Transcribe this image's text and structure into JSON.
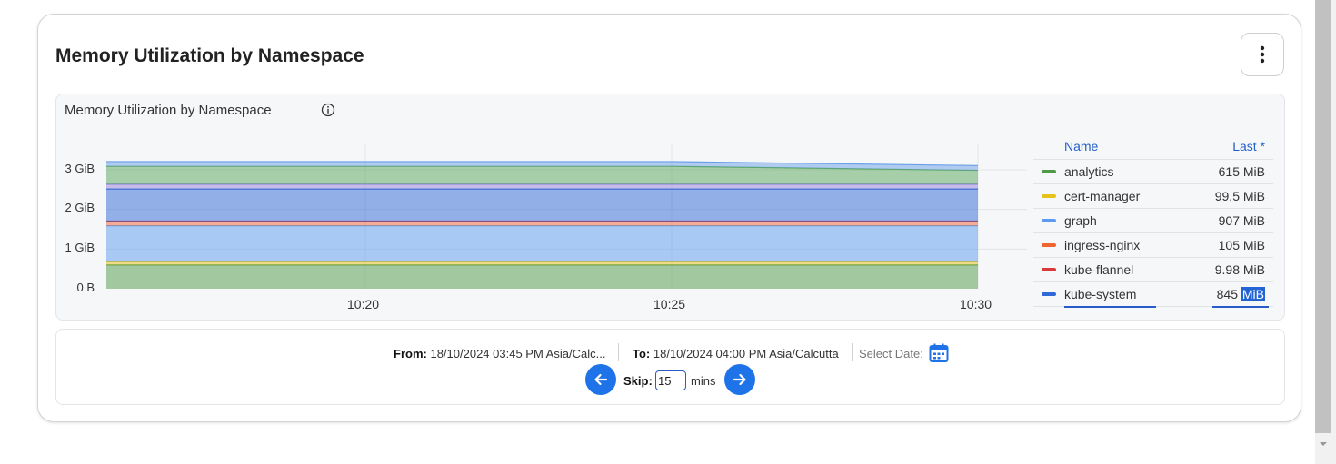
{
  "card": {
    "title": "Memory Utilization by Namespace",
    "menu_icon": "kebab-vertical-icon"
  },
  "panel": {
    "title": "Memory Utilization by Namespace",
    "info_icon": "info-icon"
  },
  "chart_data": {
    "type": "area",
    "stacked": true,
    "y_ticks": [
      "0 B",
      "1 GiB",
      "2 GiB",
      "3 GiB"
    ],
    "x_ticks": [
      "10:20",
      "10:25",
      "10:30"
    ],
    "y_unit": "GiB",
    "ylim": [
      0,
      3.2
    ],
    "grid": true,
    "legend_position": "right",
    "x": [
      "10:16",
      "10:20",
      "10:25",
      "10:30"
    ],
    "series": [
      {
        "name": "analytics",
        "color": "#4e9a47",
        "values": [
          0.6,
          0.6,
          0.6,
          0.6
        ]
      },
      {
        "name": "cert-manager",
        "color": "#e6c21a",
        "values": [
          0.097,
          0.097,
          0.097,
          0.097
        ]
      },
      {
        "name": "graph",
        "color": "#5b9cf2",
        "values": [
          0.89,
          0.89,
          0.89,
          0.89
        ]
      },
      {
        "name": "ingress-nginx",
        "color": "#f0642f",
        "values": [
          0.1,
          0.1,
          0.1,
          0.1
        ]
      },
      {
        "name": "kube-flannel",
        "color": "#d83a3a",
        "values": [
          0.01,
          0.01,
          0.01,
          0.01
        ]
      },
      {
        "name": "kube-system",
        "color": "#2f68d8",
        "values": [
          0.82,
          0.82,
          0.82,
          0.82
        ]
      },
      {
        "color": "#8f83d8",
        "values": [
          0.12,
          0.12,
          0.12,
          0.12
        ]
      },
      {
        "color": "#56a55a",
        "values": [
          0.45,
          0.45,
          0.45,
          0.35
        ]
      },
      {
        "color": "#6aa0e8",
        "values": [
          0.12,
          0.12,
          0.12,
          0.12
        ]
      }
    ]
  },
  "legend": {
    "col_name": "Name",
    "col_last": "Last *",
    "rows": [
      {
        "name": "analytics",
        "value_num": "615",
        "value_unit": "MiB",
        "color": "#4e9a47"
      },
      {
        "name": "cert-manager",
        "value_num": "99.5",
        "value_unit": "MiB",
        "color": "#e6c21a"
      },
      {
        "name": "graph",
        "value_num": "907",
        "value_unit": "MiB",
        "color": "#5b9cf2"
      },
      {
        "name": "ingress-nginx",
        "value_num": "105",
        "value_unit": "MiB",
        "color": "#f0642f"
      },
      {
        "name": "kube-flannel",
        "value_num": "9.98",
        "value_unit": "MiB",
        "color": "#d83a3a"
      },
      {
        "name": "kube-system",
        "value_num": "845",
        "value_unit": "MiB",
        "color": "#2f68d8"
      }
    ]
  },
  "controls": {
    "from_label": "From:",
    "from_value": "18/10/2024 03:45 PM Asia/Calc...",
    "to_label": "To:",
    "to_value": "18/10/2024 04:00 PM Asia/Calcutta",
    "select_date_label": "Select Date:",
    "skip_label": "Skip:",
    "skip_value": "15",
    "skip_unit": "mins",
    "prev_icon": "arrow-left-icon",
    "next_icon": "arrow-right-icon",
    "calendar_icon": "calendar-icon"
  },
  "colors": {
    "accent": "#1f73e8",
    "link": "#1f5fc9"
  }
}
